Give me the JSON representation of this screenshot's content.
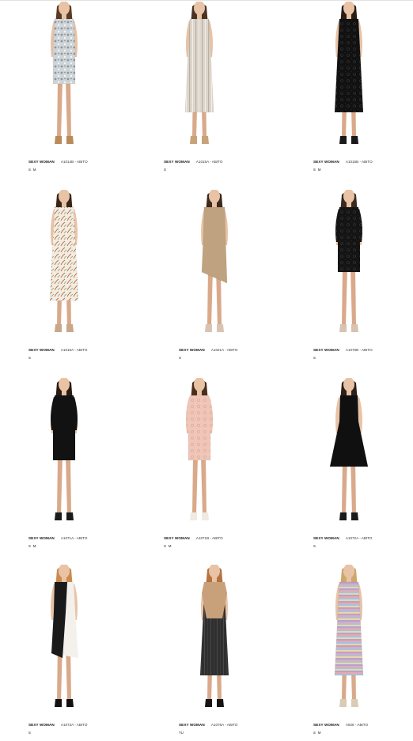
{
  "products": [
    {
      "brand": "SEXY WOMAN",
      "code": "A1014B - ABITO",
      "sizes": [
        "S",
        "M"
      ],
      "dress": "#cfd4d7",
      "pattern": "floral-grey",
      "hair": "#5a3b23",
      "shoes": "#b98a5a"
    },
    {
      "brand": "SEXY WOMAN",
      "code": "A1015A - ABITO",
      "sizes": [
        "S"
      ],
      "dress": "#dcd6cc",
      "pattern": "stripes-beige",
      "hair": "#4a3322",
      "shoes": "#c8a27a"
    },
    {
      "brand": "SEXY WOMAN",
      "code": "A1015B - ABITO",
      "sizes": [
        "S",
        "M"
      ],
      "dress": "#111111",
      "pattern": "lace-black",
      "hair": "#2b1d14",
      "shoes": "#1a1a1a"
    },
    {
      "brand": "SEXY WOMAN",
      "code": "A1016A - ABITO",
      "sizes": [
        "S"
      ],
      "dress": "#f2ece4",
      "pattern": "leaves-white",
      "hair": "#3a2618",
      "shoes": "#c9a78a"
    },
    {
      "brand": "SEXY WOMAN",
      "code": "A1021A - ABITO",
      "sizes": [
        "S"
      ],
      "dress": "#bfa27f",
      "pattern": "plain-taupe",
      "hair": "#3b2a1d",
      "shoes": "#d9c4b3"
    },
    {
      "brand": "SEXY WOMAN",
      "code": "A1070B - ABITO",
      "sizes": [
        "S"
      ],
      "dress": "#141414",
      "pattern": "lace-black",
      "hair": "#3a2a1f",
      "shoes": "#d8c2b0"
    },
    {
      "brand": "SEXY WOMAN",
      "code": "A1071A - ABITO",
      "sizes": [
        "S",
        "M"
      ],
      "dress": "#121212",
      "pattern": "plain-black",
      "hair": "#2a1b12",
      "shoes": "#1b1b1b"
    },
    {
      "brand": "SEXY WOMAN",
      "code": "A1071B - ABITO",
      "sizes": [
        "S",
        "M"
      ],
      "dress": "#efc6b8",
      "pattern": "lace-pink",
      "hair": "#4a2f1e",
      "shoes": "#f0ebe2"
    },
    {
      "brand": "SEXY WOMAN",
      "code": "A1072A - ABITO",
      "sizes": [
        "S"
      ],
      "dress": "#101010",
      "pattern": "plain-black",
      "hair": "#2e2018",
      "shoes": "#1a1a1a"
    },
    {
      "brand": "SEXY WOMAN",
      "code": "A1073A - ABITO",
      "sizes": [
        "S"
      ],
      "dress": "#1a1a1a",
      "pattern": "block-bw",
      "hair": "#c98c4e",
      "shoes": "#111111"
    },
    {
      "brand": "SEXY WOMAN",
      "code": "A1076A - ABITO",
      "sizes": [
        "TU"
      ],
      "dress": "#2f2f2f",
      "pattern": "sheer-floral",
      "hair": "#b5733f",
      "shoes": "#151515"
    },
    {
      "brand": "SEXY WOMAN",
      "code": "A928 - ABITO",
      "sizes": [
        "S",
        "M"
      ],
      "dress": "#c8a9c7",
      "pattern": "stripes-pastel",
      "hair": "#cfa66c",
      "shoes": "#d9cbb6"
    }
  ]
}
